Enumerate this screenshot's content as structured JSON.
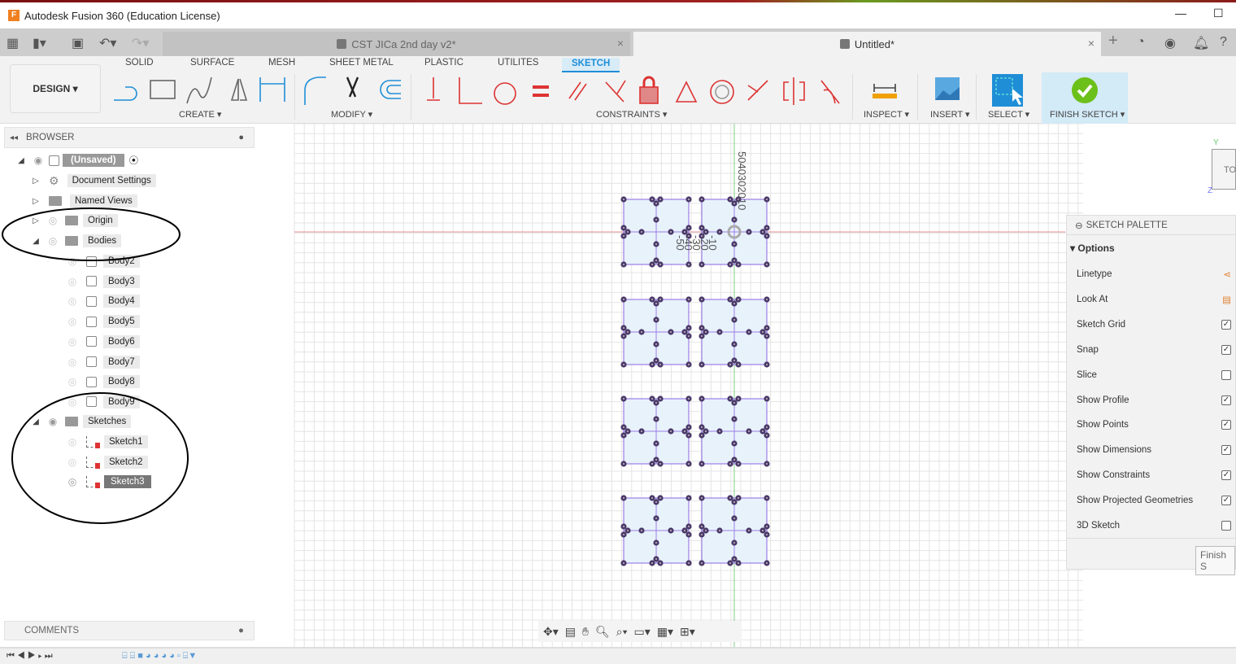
{
  "window": {
    "title": "Autodesk Fusion 360 (Education License)",
    "min": "—",
    "max": "☐"
  },
  "tabs": [
    {
      "label": "CST JICa 2nd day v2*",
      "close": "×"
    },
    {
      "label": "Untitled*",
      "close": "×"
    }
  ],
  "tabbar_icons": [
    "add-tab-icon",
    "offline-icon",
    "job-status-icon",
    "notifications-icon",
    "help-icon"
  ],
  "toolbar": {
    "workspace": "DESIGN ▾",
    "ribbon_tabs": [
      "SOLID",
      "SURFACE",
      "MESH",
      "SHEET METAL",
      "PLASTIC",
      "UTILITES",
      "SKETCH"
    ],
    "active_tab": "SKETCH",
    "groups": {
      "create": "CREATE ▾",
      "modify": "MODIFY ▾",
      "constraints": "CONSTRAINTS ▾",
      "inspect": "INSPECT ▾",
      "insert": "INSERT ▾",
      "select": "SELECT ▾",
      "finish": "FINISH SKETCH ▾"
    }
  },
  "browser": {
    "title": "BROWSER",
    "root": "(Unsaved)",
    "items": [
      {
        "label": "Document Settings"
      },
      {
        "label": "Named Views"
      },
      {
        "label": "Origin"
      },
      {
        "label": "Bodies"
      }
    ],
    "bodies": [
      "Body2",
      "Body3",
      "Body4",
      "Body5",
      "Body6",
      "Body7",
      "Body8",
      "Body9"
    ],
    "sketches_label": "Sketches",
    "sketches": [
      "Sketch1",
      "Sketch2",
      "Sketch3"
    ],
    "selected_sketch": "Sketch3"
  },
  "comments": {
    "title": "COMMENTS"
  },
  "canvas": {
    "dim_vertical": "5040302010",
    "dim_labels": [
      "-10",
      "-20",
      "-30",
      "-40",
      "-50"
    ],
    "viewcube": {
      "face": "TO",
      "y": "Y",
      "z": "Z"
    },
    "colors": {
      "sketch_line": "#9b7fe6",
      "profile_fill": "#e8f2fb",
      "point": "#4a3a6a",
      "x_axis": "#e89090",
      "y_axis": "#80d080"
    }
  },
  "palette": {
    "title": "SKETCH PALETTE",
    "section": "Options",
    "rows": [
      {
        "label": "Linetype",
        "type": "icon"
      },
      {
        "label": "Look At",
        "type": "icon"
      },
      {
        "label": "Sketch Grid",
        "checked": true
      },
      {
        "label": "Snap",
        "checked": true
      },
      {
        "label": "Slice",
        "checked": false
      },
      {
        "label": "Show Profile",
        "checked": true
      },
      {
        "label": "Show Points",
        "checked": true
      },
      {
        "label": "Show Dimensions",
        "checked": true
      },
      {
        "label": "Show Constraints",
        "checked": true
      },
      {
        "label": "Show Projected Geometries",
        "checked": true
      },
      {
        "label": "3D Sketch",
        "checked": false
      }
    ],
    "finish": "Finish S"
  }
}
